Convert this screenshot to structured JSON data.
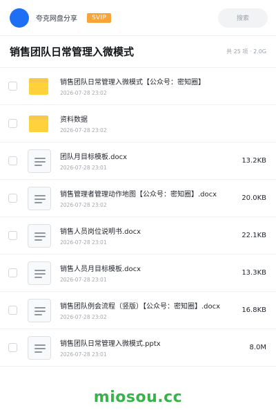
{
  "header": {
    "username": "夸克网盘分享",
    "vip_badge": "SVIP",
    "search_placeholder": "搜索",
    "accent_color": "#1f6ff5"
  },
  "folder": {
    "title": "销售团队日常管理入微模式",
    "meta": "共 25 项 · 2.0G"
  },
  "files": [
    {
      "name": "销售团队日常管理入微模式【公众号：密知圈】",
      "date": "2026-07-28 23:02",
      "size": "",
      "icon": "folder-icon"
    },
    {
      "name": "资料数据",
      "date": "2026-07-28 23:02",
      "size": "",
      "icon": "folder-icon"
    },
    {
      "name": "团队月目标模板.docx",
      "date": "2026-07-28 23:01",
      "size": "13.2KB",
      "icon": "document-icon"
    },
    {
      "name": "销售管理者管理动作地图【公众号：密知圈】.docx",
      "date": "2026-07-28 23:02",
      "size": "20.0KB",
      "icon": "document-icon"
    },
    {
      "name": "销售人员岗位说明书.docx",
      "date": "2026-07-28 23:01",
      "size": "22.1KB",
      "icon": "document-icon"
    },
    {
      "name": "销售人员月目标模板.docx",
      "date": "2026-07-28 23:01",
      "size": "13.3KB",
      "icon": "document-icon"
    },
    {
      "name": "销售团队例会流程（竖版）【公众号：密知圈】.docx",
      "date": "2026-07-28 23:02",
      "size": "16.8KB",
      "icon": "document-icon"
    },
    {
      "name": "销售团队日常管理入微模式.pptx",
      "date": "2026-07-28 23:01",
      "size": "8.0M",
      "icon": "document-icon"
    }
  ],
  "watermark": "miosou.cc"
}
